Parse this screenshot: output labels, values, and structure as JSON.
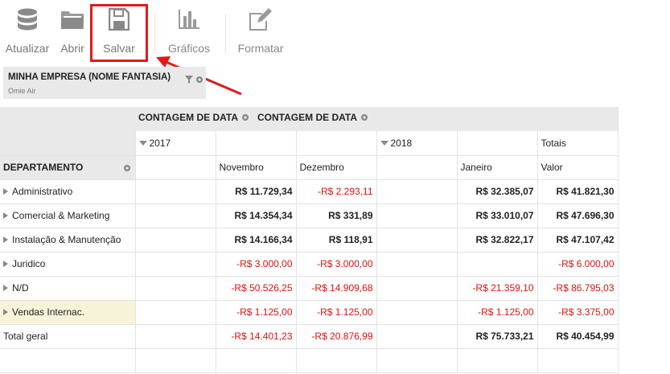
{
  "toolbar": {
    "items": [
      {
        "label": "Atualizar",
        "icon": "database-icon"
      },
      {
        "label": "Abrir",
        "icon": "folder-icon"
      },
      {
        "label": "Salvar",
        "icon": "save-icon"
      },
      {
        "label": "Gráficos",
        "icon": "bar-chart-icon"
      },
      {
        "label": "Formatar",
        "icon": "edit-icon"
      }
    ],
    "highlight_color": "#e0191d"
  },
  "filter": {
    "title": "MINHA EMPRESA (NOME FANTASIA)",
    "value": "Omie Air"
  },
  "pivot": {
    "measures": [
      "CONTAGEM DE DATA",
      "CONTAGEM DE DATA"
    ],
    "years": [
      "2017",
      "2018"
    ],
    "totals_label": "Totais",
    "row_header": "DEPARTAMENTO",
    "columns": [
      "Novembro",
      "Dezembro",
      "Janeiro",
      "Valor"
    ],
    "rows": [
      {
        "label": "Administrativo",
        "nov": "R$ 11.729,34",
        "dez": "-R$ 2.293,11",
        "jan": "R$ 32.385,07",
        "valor": "R$ 41.821,30"
      },
      {
        "label": "Comercial & Marketing",
        "nov": "R$ 14.354,34",
        "dez": "R$ 331,89",
        "jan": "R$ 33.010,07",
        "valor": "R$ 47.696,30"
      },
      {
        "label": "Instalação & Manutenção",
        "nov": "R$ 14.166,34",
        "dez": "R$ 118,91",
        "jan": "R$ 32.822,17",
        "valor": "R$ 47.107,42"
      },
      {
        "label": "Juridico",
        "nov": "-R$ 3.000,00",
        "dez": "-R$ 3.000,00",
        "jan": "",
        "valor": "-R$ 6.000,00"
      },
      {
        "label": "N/D",
        "nov": "-R$ 50.526,25",
        "dez": "-R$ 14.909,68",
        "jan": "-R$ 21.359,10",
        "valor": "-R$ 86.795,03"
      },
      {
        "label": "Vendas Internac.",
        "nov": "-R$ 1.125,00",
        "dez": "-R$ 1.125,00",
        "jan": "-R$ 1.125,00",
        "valor": "-R$ 3.375,00"
      }
    ],
    "total": {
      "label": "Total geral",
      "nov": "-R$ 14.401,23",
      "dez": "-R$ 20.876,99",
      "jan": "R$ 75.733,21",
      "valor": "R$ 40.454,99"
    },
    "negative_color": "#e01010"
  }
}
